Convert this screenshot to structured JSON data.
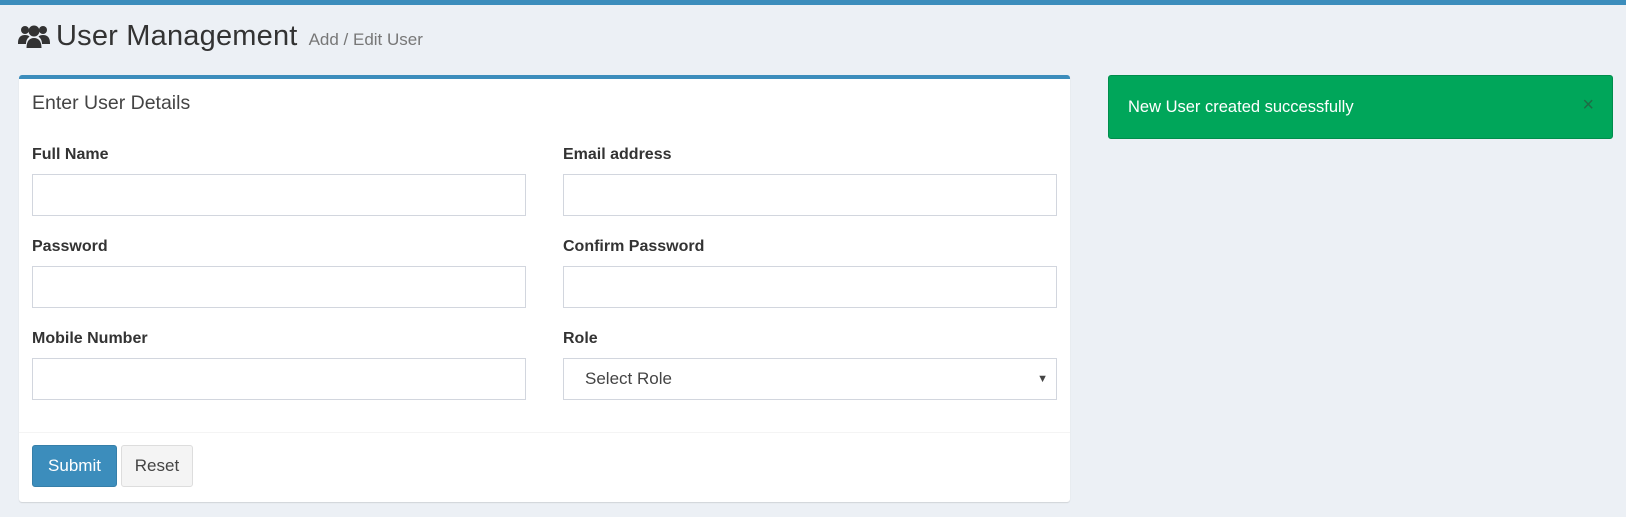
{
  "header": {
    "title": "User Management",
    "subtitle": "Add / Edit User",
    "icon": "users-icon"
  },
  "form": {
    "title": "Enter User Details",
    "fields": {
      "full_name": {
        "label": "Full Name",
        "value": ""
      },
      "email": {
        "label": "Email address",
        "value": ""
      },
      "password": {
        "label": "Password",
        "value": ""
      },
      "confirm_password": {
        "label": "Confirm Password",
        "value": ""
      },
      "mobile": {
        "label": "Mobile Number",
        "value": ""
      },
      "role": {
        "label": "Role",
        "selected": "Select Role"
      }
    },
    "buttons": {
      "submit": "Submit",
      "reset": "Reset"
    }
  },
  "alert": {
    "message": "New User created successfully",
    "close_symbol": "×",
    "color": "#00a65a"
  },
  "theme": {
    "accent": "#3c8dbc",
    "background": "#ecf0f5"
  }
}
